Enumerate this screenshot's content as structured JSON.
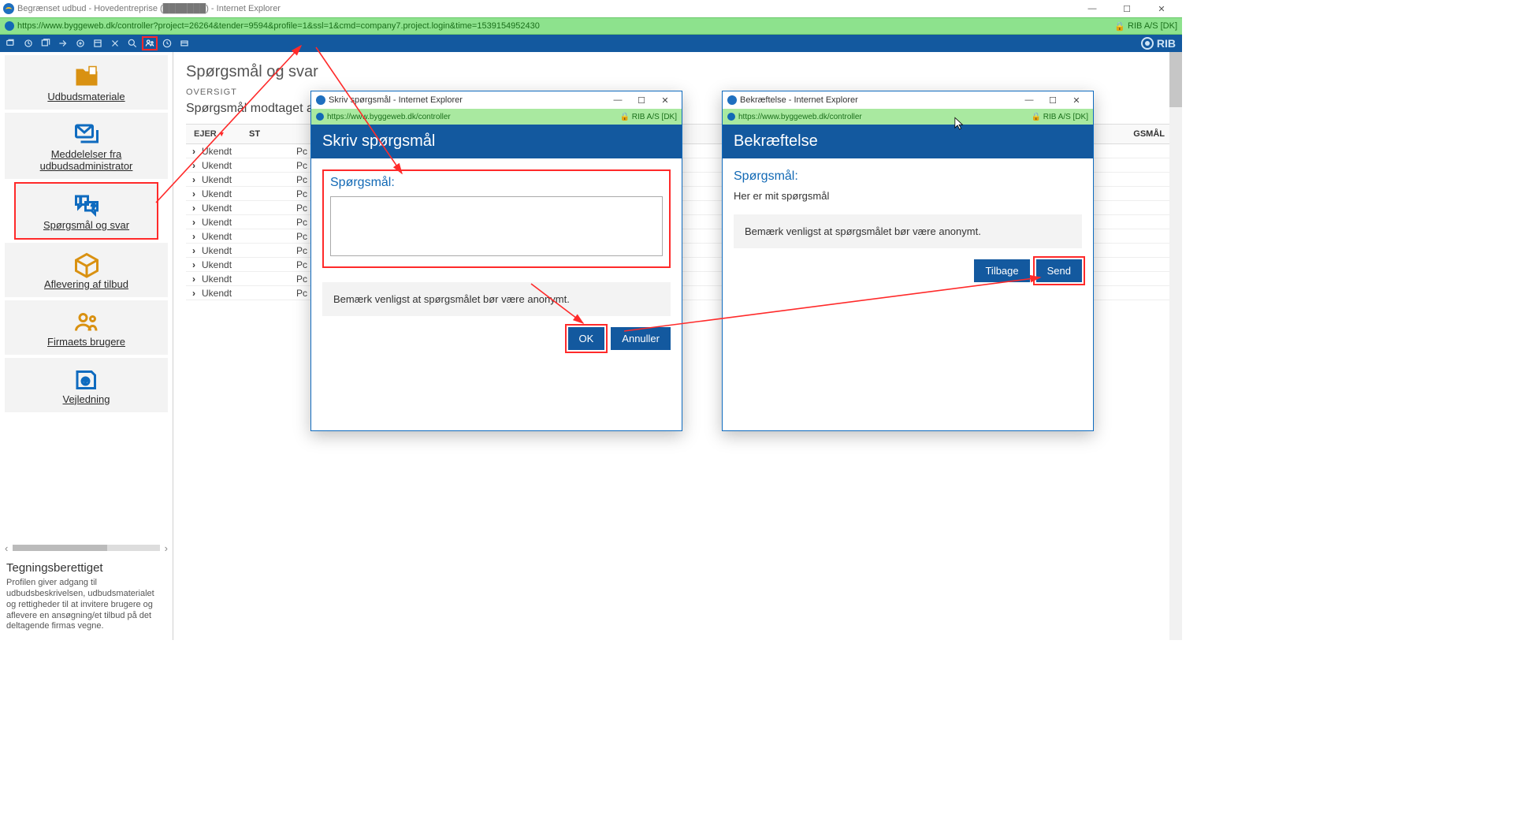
{
  "browser": {
    "title": "Begrænset udbud - Hovedentreprise (███████) - Internet Explorer",
    "url": "https://www.byggeweb.dk/controller?project=26264&tender=9594&profile=1&ssl=1&cmd=company7.project.login&time=1539154952430",
    "cert": "RIB A/S [DK]"
  },
  "toolbar": {
    "brand": "RIB"
  },
  "sidebar": {
    "items": [
      {
        "label": "Udbudsmateriale",
        "icon": "folder",
        "color": "amber"
      },
      {
        "label": "Meddelelser fra udbudsadministrator",
        "icon": "messages"
      },
      {
        "label": "Spørgsmål og svar",
        "icon": "qaspeech",
        "active": true
      },
      {
        "label": "Aflevering af tilbud",
        "icon": "package",
        "color": "amber"
      },
      {
        "label": "Firmaets brugere",
        "icon": "users",
        "color": "amber"
      },
      {
        "label": "Vejledning",
        "icon": "help"
      }
    ],
    "footer_title": "Tegningsberettiget",
    "footer_text": "Profilen giver adgang til udbudsbeskrivelsen, udbudsmaterialet og rettigheder til at invitere brugere og aflevere en ansøgning/et tilbud på det deltagende firmas vegne."
  },
  "main": {
    "title": "Spørgsmål og svar",
    "subheader": "OVERSIGT",
    "line": "Spørgsmål modtaget a...",
    "columns": {
      "ejer": "EJER",
      "st": "ST",
      "sp_tail": "GSMÅL"
    },
    "rows": [
      {
        "owner": "Ukendt",
        "p": "Pc"
      },
      {
        "owner": "Ukendt",
        "p": "Pc"
      },
      {
        "owner": "Ukendt",
        "p": "Pc"
      },
      {
        "owner": "Ukendt",
        "p": "Pc"
      },
      {
        "owner": "Ukendt",
        "p": "Pc"
      },
      {
        "owner": "Ukendt",
        "p": "Pc"
      },
      {
        "owner": "Ukendt",
        "p": "Pc"
      },
      {
        "owner": "Ukendt",
        "p": "Pc"
      },
      {
        "owner": "Ukendt",
        "p": "Pc"
      },
      {
        "owner": "Ukendt",
        "p": "Pc"
      },
      {
        "owner": "Ukendt",
        "p": "Pc"
      }
    ]
  },
  "popup1": {
    "wintitle": "Skriv spørgsmål - Internet Explorer",
    "url": "https://www.byggeweb.dk/controller",
    "cert": "RIB A/S [DK]",
    "header": "Skriv spørgsmål",
    "label": "Spørgsmål:",
    "notice": "Bemærk venligst at spørgsmålet bør være anonymt.",
    "ok": "OK",
    "cancel": "Annuller"
  },
  "popup2": {
    "wintitle": "Bekræftelse - Internet Explorer",
    "url": "https://www.byggeweb.dk/controller",
    "cert": "RIB A/S [DK]",
    "header": "Bekræftelse",
    "label": "Spørgsmål:",
    "sample": "Her er mit spørgsmål",
    "notice": "Bemærk venligst at spørgsmålet bør være anonymt.",
    "back": "Tilbage",
    "send": "Send"
  }
}
